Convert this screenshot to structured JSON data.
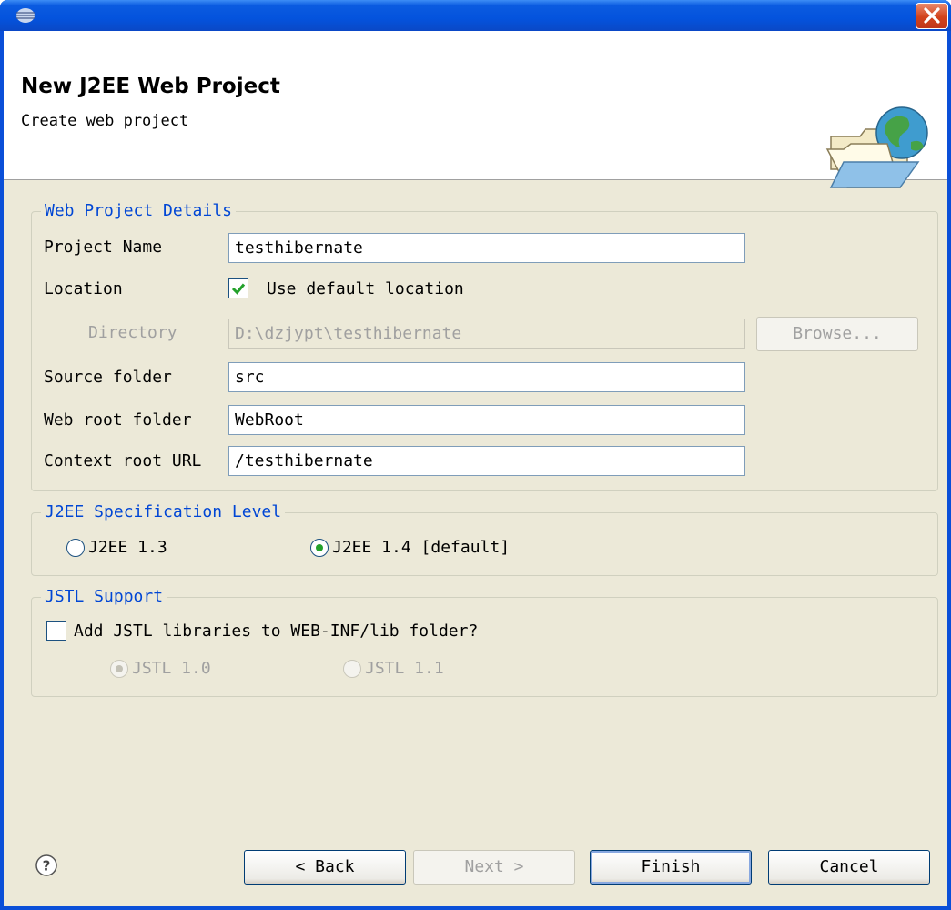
{
  "wizard": {
    "title": "New J2EE Web Project",
    "subtitle": "Create web project"
  },
  "icons": {
    "window_icon": "eclipse-icon",
    "close": "close-icon",
    "banner": "folder-globe-icon",
    "help": "help-icon"
  },
  "web_details": {
    "group_label": "Web Project Details",
    "project_name_label": "Project Name",
    "project_name_value": "testhibernate",
    "location_label": "Location",
    "use_default_label": "Use default location",
    "use_default_checked": true,
    "directory_label": "Directory",
    "directory_value": "D:\\dzjypt\\testhibernate",
    "browse_label": "Browse...",
    "source_folder_label": "Source folder",
    "source_folder_value": "src",
    "web_root_label": "Web root folder",
    "web_root_value": "WebRoot",
    "context_root_label": "Context root URL",
    "context_root_value": "/testhibernate"
  },
  "spec_level": {
    "group_label": "J2EE Specification Level",
    "option_13": "J2EE 1.3",
    "option_14": "J2EE 1.4 [default]",
    "selected": "J2EE 1.4 [default]"
  },
  "jstl": {
    "group_label": "JSTL Support",
    "add_label": "Add JSTL libraries to WEB-INF/lib folder?",
    "add_checked": false,
    "option_10": "JSTL 1.0",
    "option_11": "JSTL 1.1",
    "selected": "JSTL 1.0"
  },
  "buttons": {
    "back": "< Back",
    "next": "Next >",
    "finish": "Finish",
    "cancel": "Cancel"
  },
  "colors": {
    "title_bar": "#0453dd",
    "dialog_bg": "#ece9d8",
    "group_label": "#0046d5",
    "radio_dot": "#24a12a",
    "checkmark": "#24a12a"
  }
}
